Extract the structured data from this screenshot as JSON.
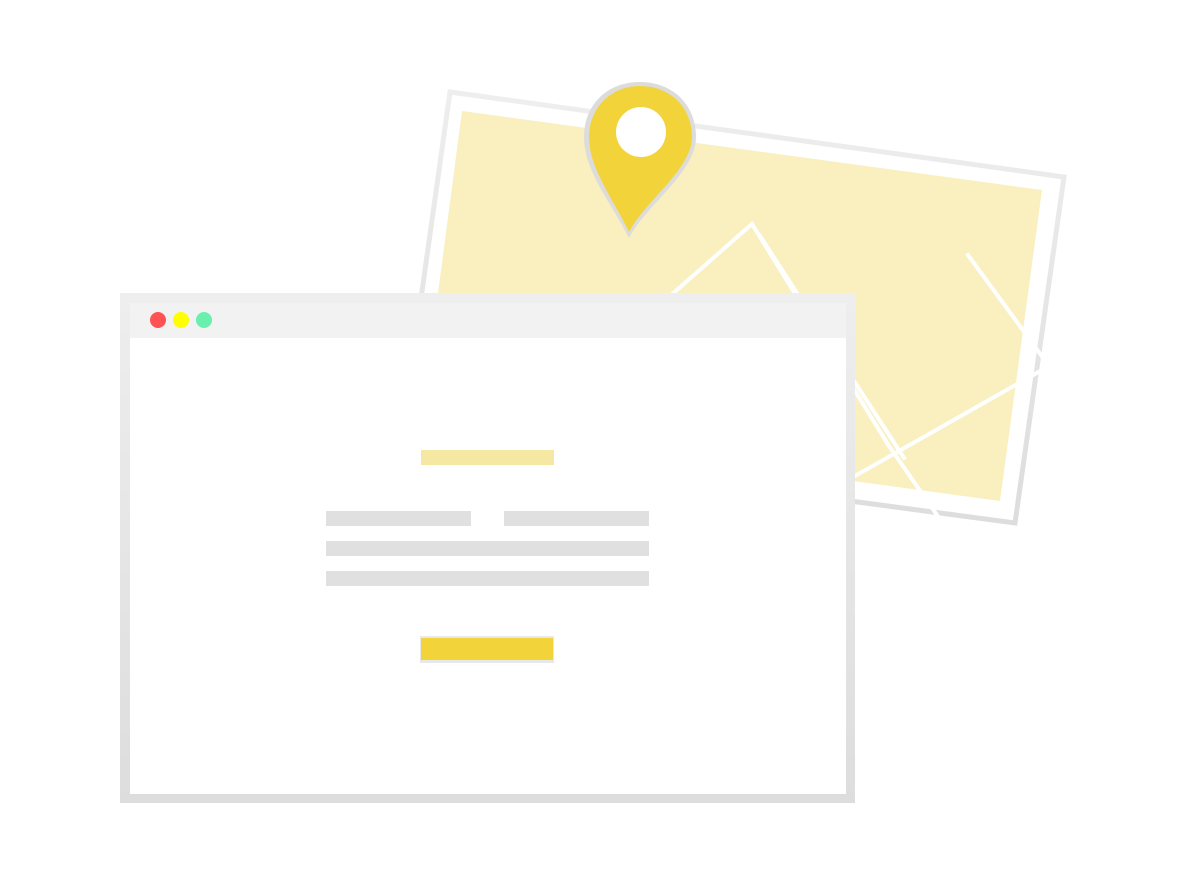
{
  "illustration": {
    "map_card": {
      "icon": "map-icon",
      "frame_color": "#eeeeee",
      "fill_color": "#f9efbf",
      "mountain_line_color": "#ffffff"
    },
    "location_pin": {
      "icon": "location-pin-icon",
      "color": "#f2d43a",
      "shadow_color": "#dcdcdc",
      "hole_color": "#ffffff"
    },
    "browser_window": {
      "frame_color": "#e7e7e7",
      "titlebar_color": "#f2f2f2",
      "content_color": "#ffffff",
      "window_controls": [
        {
          "name": "close-control",
          "icon": "red-dot-icon",
          "color": "#ff5252"
        },
        {
          "name": "minimize-control",
          "icon": "yellow-dot-icon",
          "color": "#ffff00"
        },
        {
          "name": "maximize-control",
          "icon": "green-dot-icon",
          "color": "#69f0ae"
        }
      ],
      "content_placeholder": {
        "title_bar_color": "#f5e8a3",
        "text_line_color": "#e0e0e0",
        "button_color": "#f2d43a"
      }
    }
  }
}
